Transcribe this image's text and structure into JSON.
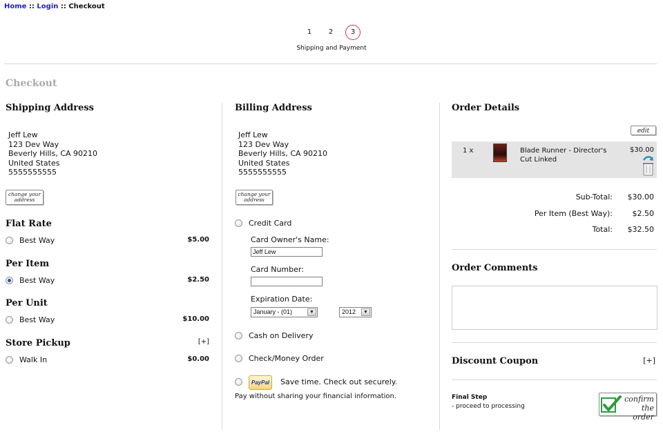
{
  "breadcrumb": {
    "home": "Home",
    "sep1": " :: ",
    "login": "Login",
    "sep2": " :: ",
    "current": "Checkout"
  },
  "steps": {
    "items": [
      "1",
      "2",
      "3"
    ],
    "active": "3",
    "caption": "Shipping and Payment"
  },
  "page_title": "Checkout",
  "shipping": {
    "title": "Shipping Address",
    "address": [
      "Jeff Lew",
      "123 Dev Way",
      "Beverly Hills, CA 90210",
      "United States",
      "5555555555"
    ],
    "change_button": "change your address",
    "methods": [
      {
        "group": "Flat Rate",
        "option": "Best Way",
        "price": "$5.00",
        "selected": false
      },
      {
        "group": "Per Item",
        "option": "Best Way",
        "price": "$2.50",
        "selected": true
      },
      {
        "group": "Per Unit",
        "option": "Best Way",
        "price": "$10.00",
        "selected": false
      },
      {
        "group": "Store Pickup",
        "expand": "[+]",
        "option": "Walk In",
        "price": "$0.00",
        "selected": false
      }
    ]
  },
  "billing": {
    "title": "Billing Address",
    "address": [
      "Jeff Lew",
      "123 Dev Way",
      "Beverly Hills, CA 90210",
      "United States",
      "5555555555"
    ],
    "change_button": "change your address",
    "credit_card": {
      "label": "Credit Card",
      "owner_label": "Card Owner's Name:",
      "owner_value": "Jeff Lew",
      "number_label": "Card Number:",
      "number_value": "",
      "expiry_label": "Expiration Date:",
      "month_value": "January - (01)",
      "year_value": "2012"
    },
    "cod_label": "Cash on Delivery",
    "check_label": "Check/Money Order",
    "paypal": {
      "logo": "PayPal",
      "tagline": "Save time. Check out securely.",
      "note": "Pay without sharing your financial information."
    }
  },
  "order": {
    "title": "Order Details",
    "edit_button": "edit",
    "item": {
      "qty": "1 x",
      "name": "Blade Runner - Director's Cut Linked",
      "price": "$30.00"
    },
    "subtotal_label": "Sub-Total:",
    "subtotal_value": "$30.00",
    "shipping_label": "Per Item (Best Way):",
    "shipping_value": "$2.50",
    "total_label": "Total:",
    "total_value": "$32.50"
  },
  "comments": {
    "title": "Order Comments",
    "value": ""
  },
  "coupon": {
    "title": "Discount Coupon",
    "expand": "[+]"
  },
  "final": {
    "title": "Final Step",
    "subtitle": "- proceed to processing",
    "confirm_button": "confirm the order"
  },
  "colors": {
    "link": "#2020c0",
    "active_step": "#dd3333",
    "order_row_bg": "#e4e4e4",
    "confirm_check": "#2e9b3a"
  }
}
